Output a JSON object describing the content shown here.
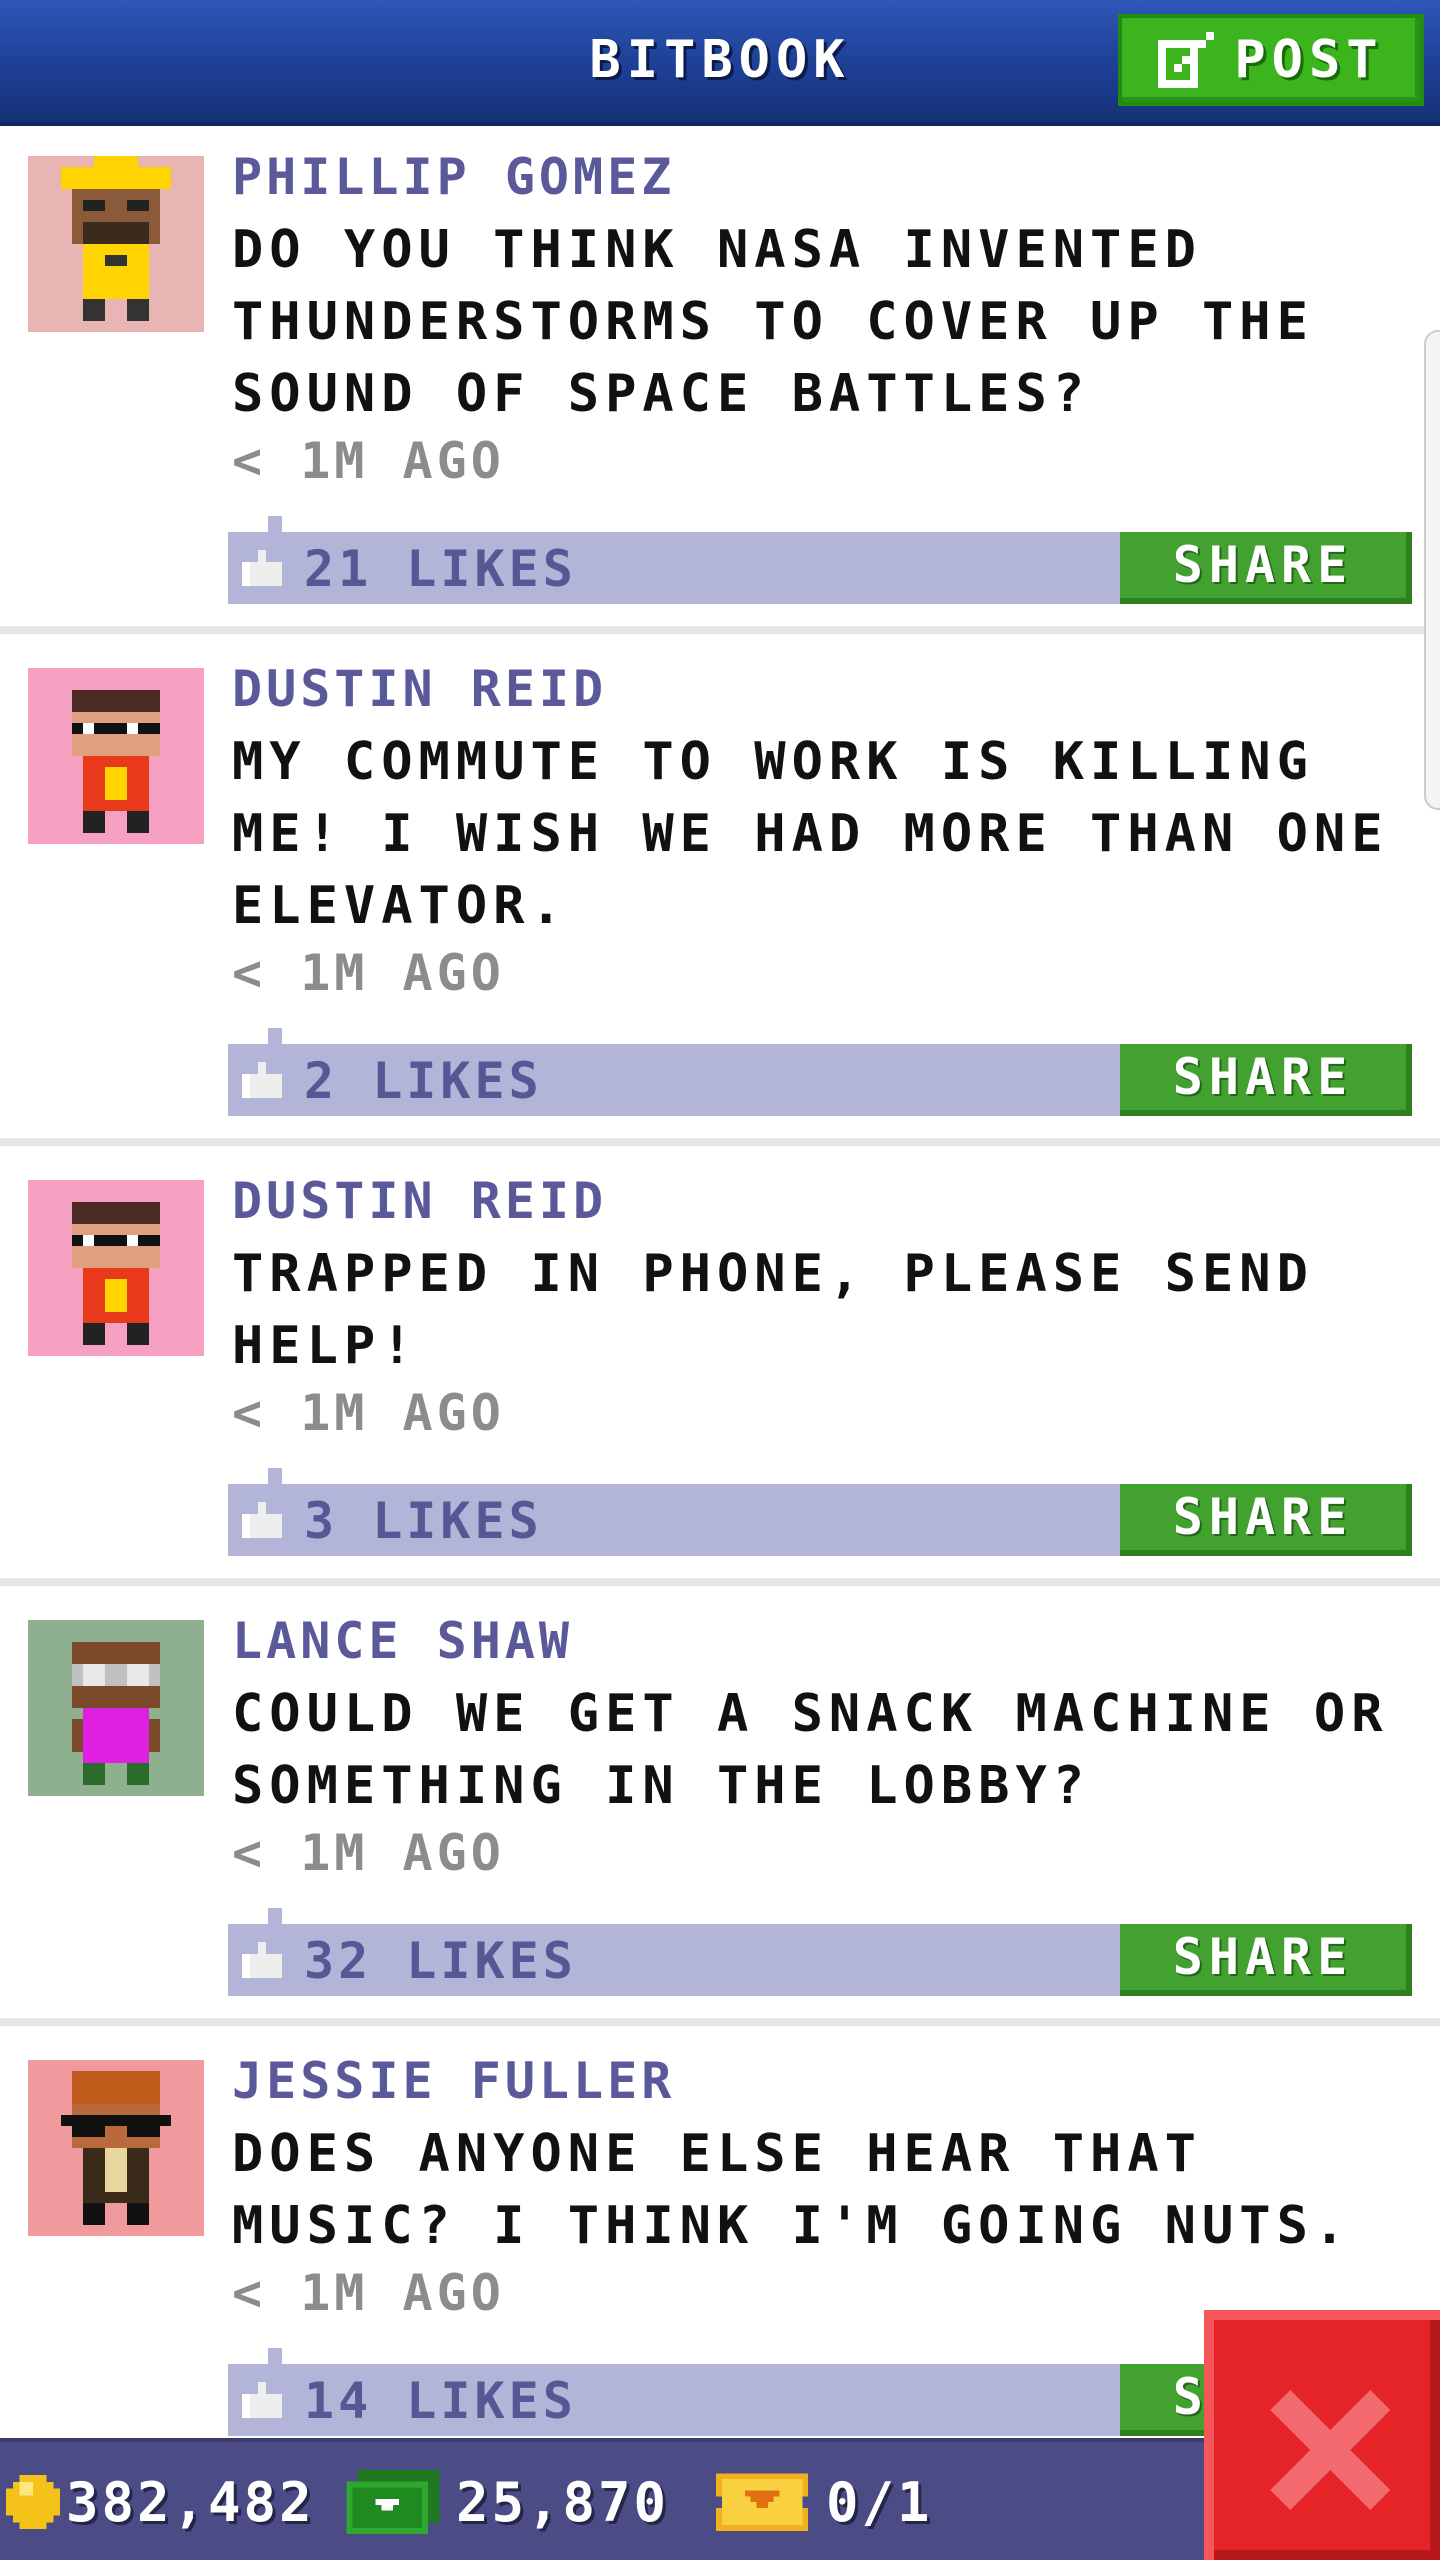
{
  "header": {
    "title": "BITBOOK",
    "post_label": "POST"
  },
  "posts": [
    {
      "author": "PHILLIP GOMEZ",
      "message": "DO YOU THINK NASA INVENTED THUNDERSTORMS TO COVER UP THE SOUND OF SPACE BATTLES?",
      "time": "< 1M AGO",
      "likes": "21 LIKES",
      "share_label": "SHARE",
      "avatar_bg": "#e8b4b4"
    },
    {
      "author": "DUSTIN REID",
      "message": "MY COMMUTE TO WORK IS KILLING ME! I WISH WE HAD MORE THAN ONE ELEVATOR.",
      "time": "< 1M AGO",
      "likes": "2 LIKES",
      "share_label": "SHARE",
      "avatar_bg": "#f5a0c0"
    },
    {
      "author": "DUSTIN REID",
      "message": "TRAPPED IN PHONE, PLEASE SEND HELP!",
      "time": "< 1M AGO",
      "likes": "3 LIKES",
      "share_label": "SHARE",
      "avatar_bg": "#f5a0c0"
    },
    {
      "author": "LANCE SHAW",
      "message": "COULD WE GET A SNACK MACHINE OR SOMETHING IN THE LOBBY?",
      "time": "< 1M AGO",
      "likes": "32 LIKES",
      "share_label": "SHARE",
      "avatar_bg": "#8fb08f"
    },
    {
      "author": "JESSIE FULLER",
      "message": "DOES ANYONE ELSE HEAR THAT MUSIC? I THINK I'M GOING NUTS.",
      "time": "< 1M AGO",
      "likes": "14 LIKES",
      "share_label": "SHARE",
      "avatar_bg": "#f09a9e"
    }
  ],
  "footer": {
    "coins": "382,482",
    "bux": "25,870",
    "tickets": "0/1"
  },
  "icons": {
    "post": "edit-icon",
    "like": "thumb-up-icon",
    "coin": "coin-icon",
    "bux": "cash-icon",
    "ticket": "ticket-icon",
    "close": "close-icon"
  },
  "colors": {
    "header": "#1d3f95",
    "post_button": "#3bb41d",
    "share_button": "#43a22f",
    "likes_bar": "#b3b5d8",
    "author_text": "#5a5a9a",
    "bottom_bar": "#4b4b86",
    "close_button": "#e5242a"
  }
}
